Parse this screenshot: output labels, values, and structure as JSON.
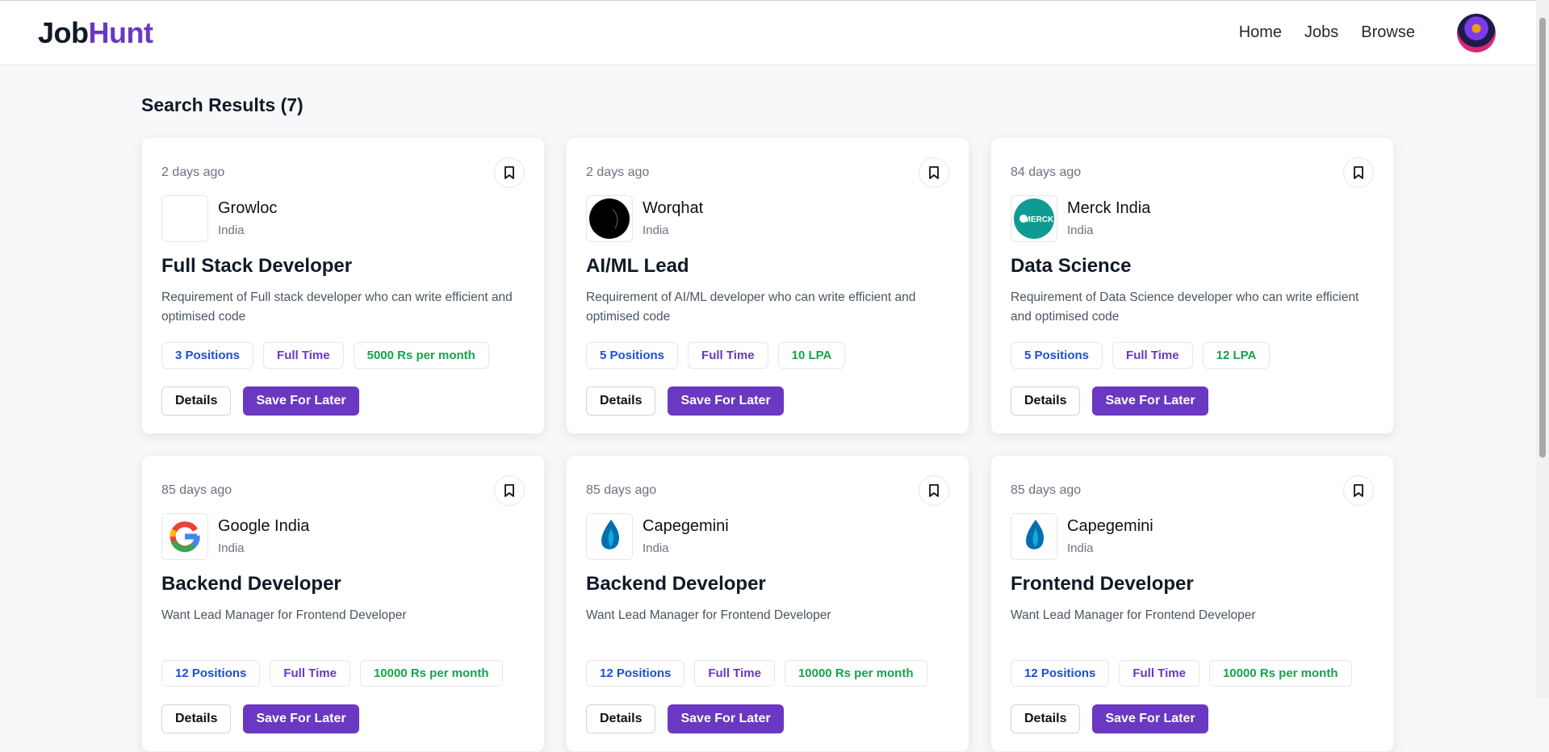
{
  "brand": {
    "part1": "Job",
    "part2": "Hunt"
  },
  "nav": {
    "home": "Home",
    "jobs": "Jobs",
    "browse": "Browse"
  },
  "results": {
    "title": "Search Results (7)"
  },
  "colors": {
    "accent": "#6a38c2",
    "blue": "#1d4ed8",
    "green": "#16a34a"
  },
  "actions": {
    "details": "Details",
    "save": "Save For Later"
  },
  "jobs": [
    {
      "posted": "2 days ago",
      "company": "Growloc",
      "location": "India",
      "logo": "blank-logo",
      "title": "Full Stack Developer",
      "description": "Requirement of Full stack developer who can write efficient and optimised code",
      "positions": "3 Positions",
      "type": "Full Time",
      "salary": "5000 Rs per month"
    },
    {
      "posted": "2 days ago",
      "company": "Worqhat",
      "location": "India",
      "logo": "worqhat-logo",
      "title": "AI/ML Lead",
      "description": "Requirement of AI/ML developer who can write efficient and optimised code",
      "positions": "5 Positions",
      "type": "Full Time",
      "salary": "10 LPA"
    },
    {
      "posted": "84 days ago",
      "company": "Merck India",
      "location": "India",
      "logo": "merck-logo",
      "logo_text": "MERCK",
      "title": "Data Science",
      "description": "Requirement of Data Science developer who can write efficient and optimised code",
      "positions": "5 Positions",
      "type": "Full Time",
      "salary": "12 LPA"
    },
    {
      "posted": "85 days ago",
      "company": "Google India",
      "location": "India",
      "logo": "google-logo",
      "title": "Backend Developer",
      "description": "Want Lead Manager for Frontend Developer",
      "positions": "12 Positions",
      "type": "Full Time",
      "salary": "10000 Rs per month"
    },
    {
      "posted": "85 days ago",
      "company": "Capegemini",
      "location": "India",
      "logo": "capgemini-logo",
      "title": "Backend Developer",
      "description": "Want Lead Manager for Frontend Developer",
      "positions": "12 Positions",
      "type": "Full Time",
      "salary": "10000 Rs per month"
    },
    {
      "posted": "85 days ago",
      "company": "Capegemini",
      "location": "India",
      "logo": "capgemini-logo",
      "title": "Frontend Developer",
      "description": "Want Lead Manager for Frontend Developer",
      "positions": "12 Positions",
      "type": "Full Time",
      "salary": "10000 Rs per month"
    }
  ]
}
